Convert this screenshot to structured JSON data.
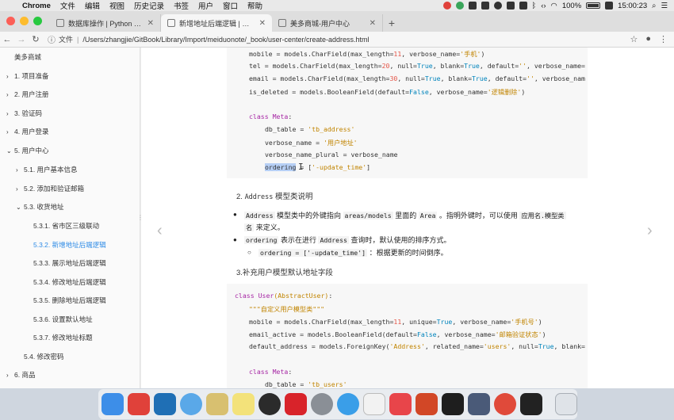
{
  "menubar": {
    "apple": "",
    "items": [
      "Chrome",
      "文件",
      "编辑",
      "视图",
      "历史记录",
      "书签",
      "用户",
      "窗口",
      "帮助"
    ],
    "battery": "100%",
    "clock": "15:00:23"
  },
  "tabs": [
    {
      "label": "数据库操作 | Python Web 框架",
      "active": false
    },
    {
      "label": "新增地址后端逻辑 | 欢迎来到美",
      "active": true
    },
    {
      "label": "美多商城-用户中心",
      "active": false
    }
  ],
  "addressbar": {
    "label": "文件",
    "url": "/Users/zhangjie/GitBook/Library/Import/meiduonote/_book/user-center/create-address.html"
  },
  "sidebar": {
    "brand": "美多商城",
    "items": [
      {
        "label": "1. 项目准备",
        "arrow": "›"
      },
      {
        "label": "2. 用户注册",
        "arrow": "›"
      },
      {
        "label": "3. 验证码",
        "arrow": "›"
      },
      {
        "label": "4. 用户登录",
        "arrow": "›"
      },
      {
        "label": "5. 用户中心",
        "arrow": "⌄"
      },
      {
        "label": "5.1. 用户基本信息",
        "arrow": "›"
      },
      {
        "label": "5.2. 添加和验证邮箱",
        "arrow": "›"
      },
      {
        "label": "5.3. 收货地址",
        "arrow": "⌄"
      },
      {
        "label": "5.3.1. 省市区三级联动",
        "arrow": ""
      },
      {
        "label": "5.3.2. 新增地址后端逻辑",
        "arrow": ""
      },
      {
        "label": "5.3.3. 展示地址后端逻辑",
        "arrow": ""
      },
      {
        "label": "5.3.4. 修改地址后端逻辑",
        "arrow": ""
      },
      {
        "label": "5.3.5. 删除地址后端逻辑",
        "arrow": ""
      },
      {
        "label": "5.3.6. 设置默认地址",
        "arrow": ""
      },
      {
        "label": "5.3.7. 修改地址标题",
        "arrow": ""
      },
      {
        "label": "5.4. 修改密码",
        "arrow": ""
      },
      {
        "label": "6. 商品",
        "arrow": "›"
      }
    ]
  },
  "code1": {
    "l1a": "mobile = models.CharField(max_length=",
    "l1n": "11",
    "l1b": ", verbose_name=",
    "l1s": "'手机'",
    "l1c": ")",
    "l2a": "tel = models.CharField(max_length=",
    "l2n": "20",
    "l2b": ", null=",
    "l2t1": "True",
    "l2c": ", blank=",
    "l2t2": "True",
    "l2d": ", default=",
    "l2s": "''",
    "l2e": ", verbose_name=",
    "l3a": "email = models.CharField(max_length=",
    "l3n": "30",
    "l3b": ", null=",
    "l3t1": "True",
    "l3c": ", blank=",
    "l3t2": "True",
    "l3d": ", default=",
    "l3s": "''",
    "l3e": ", verbose_nam",
    "l4a": "is_deleted = models.BooleanField(default=",
    "l4f": "False",
    "l4b": ", verbose_name=",
    "l4s": "'逻辑删除'",
    "l4c": ")",
    "meta_kw": "class",
    "meta_name": " Meta",
    "meta_colon": ":",
    "db_table": "db_table = ",
    "db_table_v": "'tb_address'",
    "vn": "verbose_name = ",
    "vn_v": "'用户地址'",
    "vnp": "verbose_name_plural = verbose_name",
    "ord_sel": "ordering",
    "ord_rest": " = [",
    "ord_v": "'-update_time'",
    "ord_end": "]"
  },
  "section2": {
    "heading_num": "2. ",
    "heading_code": "Address",
    "heading_text": " 模型类说明",
    "b1_code1": "Address",
    "b1_t1": " 模型类中的外键指向 ",
    "b1_code2": "areas/models",
    "b1_t2": " 里面的 ",
    "b1_code3": "Area",
    "b1_t3": " 。指明外键时，可以使用 ",
    "b1_code4": "应用名.模型类",
    "b1_line2_code": "名",
    "b1_line2_t": " 来定义。",
    "b2_code": "ordering",
    "b2_t1": " 表示在进行 ",
    "b2_code2": "Address",
    "b2_t2": " 查询时，默认使用的排序方式。",
    "b3_code": "ordering = ['-update_time']",
    "b3_t": " ：根据更新的时间倒序。"
  },
  "section3": {
    "heading": "3.补充用户模型默认地址字段"
  },
  "code2": {
    "c_kw": "class",
    "c_name": " User",
    "c_base": "(AbstractUser)",
    "c_colon": ":",
    "doc": "\"\"\"自定义用户模型类\"\"\"",
    "m1a": "mobile = models.CharField(max_length=",
    "m1n": "11",
    "m1b": ", unique=",
    "m1t": "True",
    "m1c": ", verbose_name=",
    "m1s": "'手机号'",
    "m1d": ")",
    "m2a": "email_active = models.BooleanField(default=",
    "m2f": "False",
    "m2b": ", verbose_name=",
    "m2s": "'邮箱验证状态'",
    "m2c": ")",
    "m3a": "default_address = models.ForeignKey(",
    "m3s": "'Address'",
    "m3b": ", related_name=",
    "m3s2": "'users'",
    "m3c": ", null=",
    "m3t": "True",
    "m3d": ", blank=",
    "meta_kw": "class",
    "meta_name": " Meta",
    "meta_colon": ":",
    "db_table": "db_table = ",
    "db_table_v": "'tb_users'"
  },
  "colors": {
    "accent": "#2e8be6",
    "keyword": "#a626a4",
    "string": "#c18401",
    "number": "#e45649",
    "bool": "#0184bc"
  },
  "dock": {
    "icons": [
      "finder-icon",
      "git-icon",
      "vscode-icon",
      "bird-icon",
      "books-icon",
      "notes-icon",
      "obs-icon",
      "youdao-icon",
      "settings-icon",
      "safari-icon",
      "typora-icon",
      "xmind-icon",
      "powerpoint-icon",
      "pycharm-icon",
      "sublime-icon",
      "chrome-icon",
      "terminal-icon",
      "trash-icon"
    ]
  }
}
